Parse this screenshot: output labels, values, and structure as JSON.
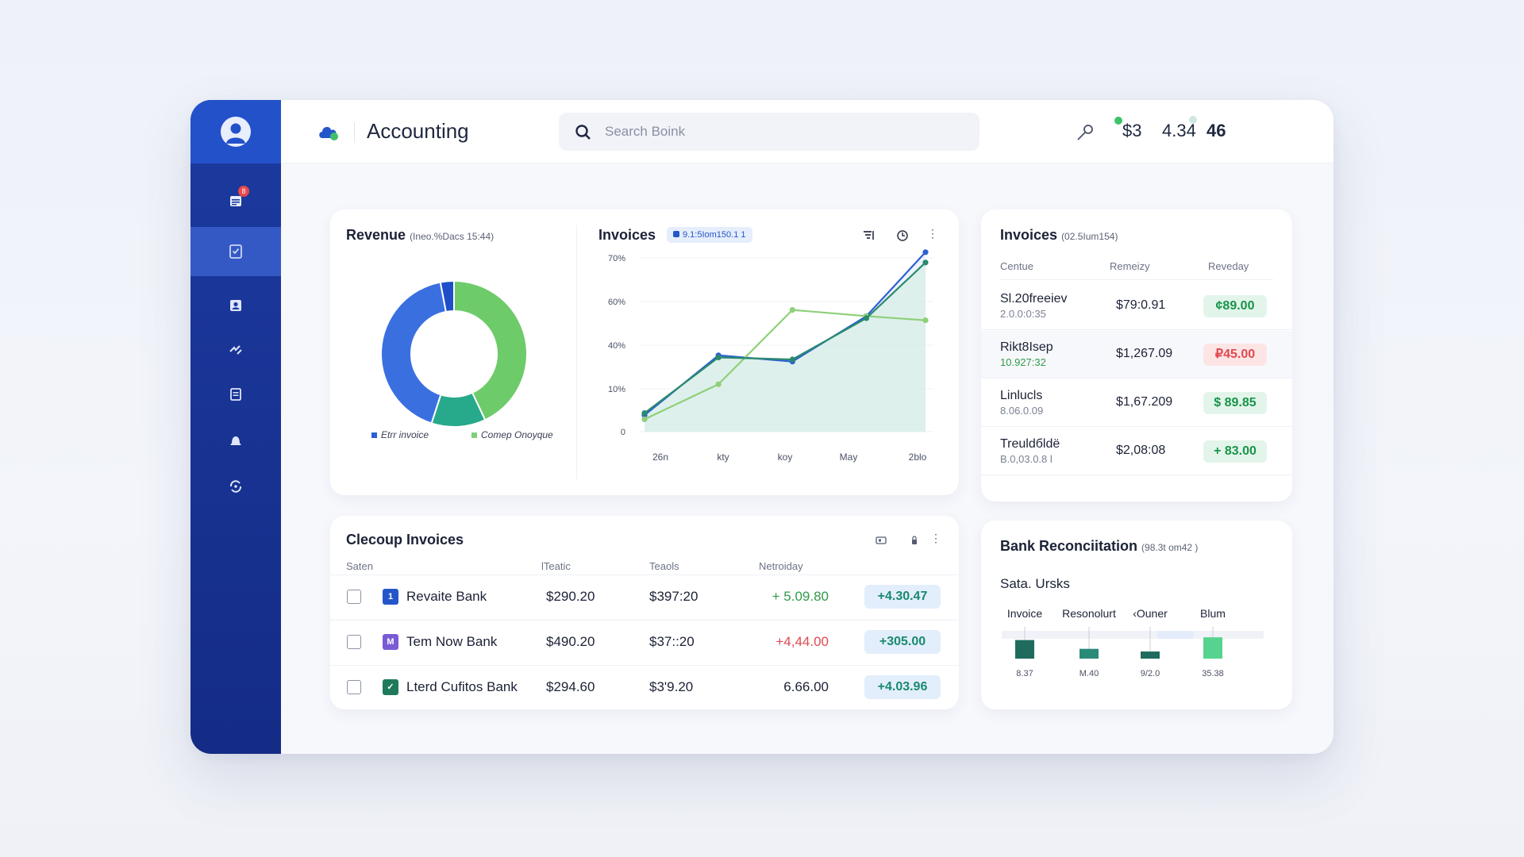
{
  "app": {
    "title": "Accounting",
    "search_placeholder": "Search Boink",
    "stats": [
      "$3",
      "4.34",
      "46"
    ],
    "notification_count": "8"
  },
  "sidebar": {
    "items": [
      {
        "icon": "calendar-icon",
        "active": false
      },
      {
        "icon": "checklist-icon",
        "active": true
      },
      {
        "icon": "contacts-icon",
        "active": false
      },
      {
        "icon": "transfer-icon",
        "active": false
      },
      {
        "icon": "document-icon",
        "active": false
      },
      {
        "icon": "bell-icon",
        "active": false
      },
      {
        "icon": "sync-icon",
        "active": false
      }
    ]
  },
  "revenue": {
    "title": "Revenue",
    "subtitle": "(Ineo.%Dacs 15:44)",
    "legend": [
      "Etrr invoice",
      "Comep Onoyque"
    ]
  },
  "invoices_chart": {
    "title": "Invoices",
    "badge": "9.1:5Iom150.1 1"
  },
  "chart_data": [
    {
      "type": "pie",
      "title": "Revenue",
      "labels": [
        "Comep Onoyque",
        "teal segment",
        "Etrr invoice",
        "navy segment"
      ],
      "values": [
        43,
        12,
        42,
        3
      ],
      "colors": [
        "#6ecb6a",
        "#27a98b",
        "#3a6fe0",
        "#1e4ec8"
      ]
    },
    {
      "type": "line",
      "title": "Invoices",
      "categories": [
        "26n",
        "kty",
        "koy",
        "May",
        "2blo"
      ],
      "y_ticks": [
        "0",
        "10%",
        "40%",
        "60%",
        "70%"
      ],
      "series": [
        {
          "color": "#2d60d4",
          "x": [
            0,
            1,
            2,
            3,
            3.8
          ],
          "y": [
            8,
            37,
            34,
            56,
            87
          ],
          "fill": "#dfe7fb"
        },
        {
          "color": "#8fd07a",
          "x": [
            0,
            1,
            2,
            3,
            3.8
          ],
          "y": [
            6,
            23,
            59,
            56,
            54
          ],
          "fill": null
        },
        {
          "color": "#2a8a6c",
          "x": [
            0,
            1,
            2,
            3,
            3.8
          ],
          "y": [
            9,
            36,
            35,
            55,
            82
          ],
          "fill": "#cfeede"
        }
      ]
    },
    {
      "type": "bar",
      "title": "Sata. Ursks",
      "categories": [
        "Invoice",
        "Resonolurt",
        "‹Ouner",
        "Blum"
      ],
      "value_labels": [
        "8.37",
        "M.40",
        "9/2.0",
        "35.38"
      ],
      "values": [
        8.37,
        4.4,
        3.2,
        9.6
      ],
      "colors": [
        "#1f6b5e",
        "#2a8a78",
        "#1f6b5e",
        "#56d38e"
      ]
    }
  ],
  "invoices_list": {
    "title": "Invoices",
    "subtitle": "(02.5Ium154)",
    "headers": [
      "Centue",
      "Remeizy",
      "Reveday"
    ],
    "rows": [
      {
        "name": "Sl.20freeiev",
        "sub": "2.0.0:0:35",
        "amount": "$79:0.91",
        "change": "¢89.00",
        "tone": "green",
        "highlight": false,
        "sub_green": false
      },
      {
        "name": "Rikt8Isep",
        "sub": "10.927:32",
        "amount": "$1,267.09",
        "change": "₽45.00",
        "tone": "red",
        "highlight": true,
        "sub_green": true
      },
      {
        "name": "Linlucls",
        "sub": "8.06.0.09",
        "amount": "$1,67.209",
        "change": "$ 89.85",
        "tone": "green",
        "highlight": false,
        "sub_green": false
      },
      {
        "name": "Treuldбldё",
        "sub": "B.0,03.0.8 l",
        "amount": "$2,08:08",
        "change": "+ 83.00",
        "tone": "green",
        "highlight": false,
        "sub_green": false
      }
    ]
  },
  "clecoup": {
    "title": "Clecoup Invoices",
    "headers": [
      "Saten",
      "lTeatic",
      "Teaols",
      "Netroiday"
    ],
    "rows": [
      {
        "badge": "1",
        "badge_color": "#2456c9",
        "bank": "Revaite Bank",
        "col1": "$290.20",
        "col2": "$397:20",
        "col3": "+ 5.09.80",
        "col3_color": "#2f9b4b",
        "pill": "+4.30.47"
      },
      {
        "badge": "M",
        "badge_color": "#7b5ad6",
        "bank": "Tem Now Bank",
        "col1": "$490.20",
        "col2": "$37::20",
        "col3": "+4,44.00",
        "col3_color": "#e1484f",
        "pill": "+305.00"
      },
      {
        "badge": "✓",
        "badge_color": "#1e7a5b",
        "bank": "Lterd Cufitos Bank",
        "col1": "$294.60",
        "col2": "$3'9.20",
        "col3": "6.66.00",
        "col3_color": "#1c2236",
        "pill": "+4.03.96"
      }
    ]
  },
  "bank_rec": {
    "title": "Bank Reconciitation",
    "subtitle": "(98.3t om42 )",
    "section": "Sata. Ursks"
  }
}
